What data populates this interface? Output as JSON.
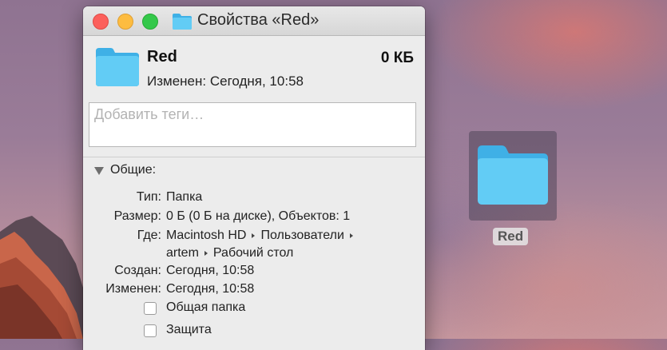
{
  "window": {
    "title": "Свойства «Red»",
    "title_icon": "folder-icon"
  },
  "header": {
    "name": "Red",
    "size": "0 КБ",
    "modified": "Изменен: Сегодня, 10:58"
  },
  "tags": {
    "placeholder": "Добавить теги…",
    "value": ""
  },
  "general": {
    "section_label": "Общие:",
    "type_label": "Тип:",
    "type_value": "Папка",
    "size_label": "Размер:",
    "size_value": "0 Б (0 Б на диске), Объектов: 1",
    "where_label": "Где:",
    "where_path": [
      "Macintosh HD",
      "Пользователи",
      "artem",
      "Рабочий стол"
    ],
    "created_label": "Создан:",
    "created_value": "Сегодня, 10:58",
    "modified_label": "Изменен:",
    "modified_value": "Сегодня, 10:58",
    "shared_folder_label": "Общая папка",
    "shared_folder_checked": false,
    "locked_label": "Защита",
    "locked_checked": false
  },
  "desktop": {
    "folder_name": "Red",
    "folder_icon": "folder-icon"
  },
  "colors": {
    "folder_blue": "#5ec8f2",
    "window_bg": "#ececec"
  }
}
